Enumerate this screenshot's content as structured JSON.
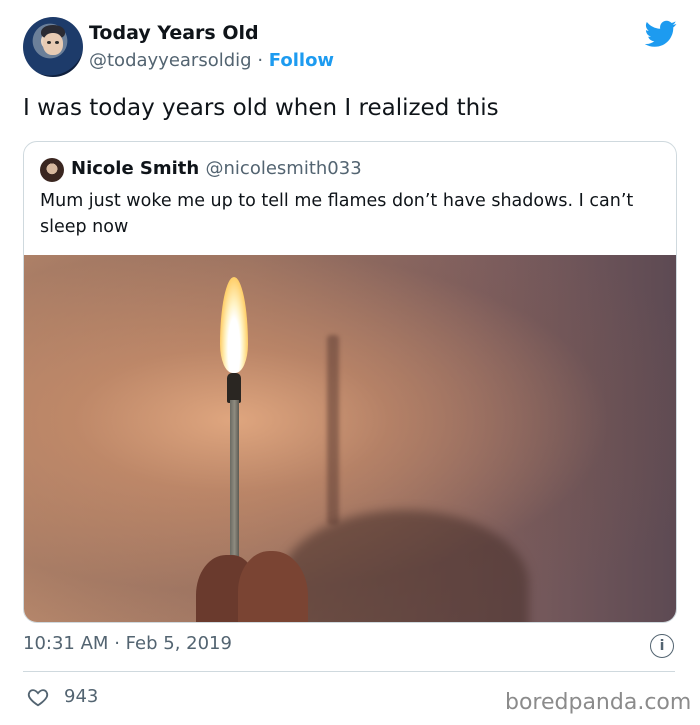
{
  "author": {
    "name": "Today Years Old",
    "handle": "@todayyearsoldig",
    "separator": "·",
    "follow_label": "Follow"
  },
  "tweet": {
    "text": "I was today years old when I realized this",
    "time": "10:31 AM",
    "separator": "·",
    "date": "Feb 5, 2019",
    "likes": "943"
  },
  "quoted": {
    "name": "Nicole Smith",
    "handle": "@nicolesmith033",
    "text": "Mum just woke me up to tell me flames don’t have shadows. I can’t sleep now"
  },
  "icons": {
    "brand": "twitter-bird-icon",
    "info": "info-icon",
    "like": "heart-icon"
  },
  "colors": {
    "accent": "#1d9bf0",
    "muted": "#536471",
    "border": "#cfd9de"
  },
  "watermark": "boredpanda.com"
}
